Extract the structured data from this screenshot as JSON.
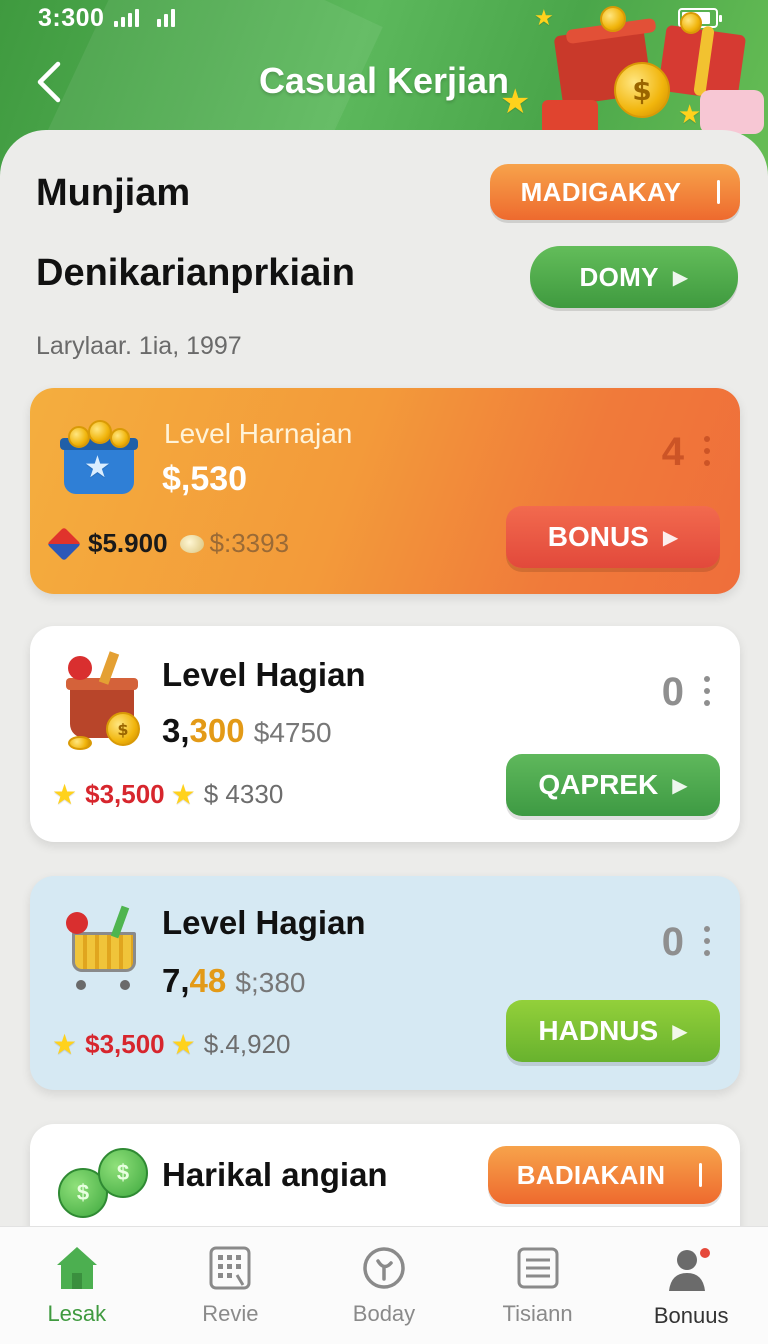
{
  "status_bar": {
    "time": "3:300"
  },
  "header": {
    "title": "Casual Kerjian"
  },
  "intro": {
    "title_line_1": "Munjiam",
    "title_line_2": "Denikarianprkiain",
    "subtitle": "Larylaar. 1ia, 1997",
    "top_button_label": "MADIGAKAY",
    "green_button_label": "DOMY"
  },
  "cards": [
    {
      "level_label": "Level Harnajan",
      "amount": "$,530",
      "counter": "4",
      "stat_primary": "$5.900",
      "stat_secondary": "$:3393",
      "button_label": "BONUS"
    },
    {
      "level_label": "Level Hagian",
      "amount_lead": "3,",
      "amount_highlight": "300",
      "amount_sub": "$4750",
      "counter": "0",
      "stat_primary": "$3,500",
      "stat_secondary": "$ 4330",
      "button_label": "QAPREK"
    },
    {
      "level_label": "Level Hagian",
      "amount_lead": "7,",
      "amount_highlight": "48",
      "amount_sub": "$;380",
      "counter": "0",
      "stat_primary": "$3,500",
      "stat_secondary": "$.4,920",
      "button_label": "HADNUS"
    },
    {
      "level_label": "Harikal angian",
      "button_label": "BADIAKAIN"
    }
  ],
  "nav": {
    "items": [
      {
        "label": "Lesak",
        "icon": "home-icon"
      },
      {
        "label": "Revie",
        "icon": "grid-icon"
      },
      {
        "label": "Boday",
        "icon": "compass-icon"
      },
      {
        "label": "Tisiann",
        "icon": "list-icon"
      },
      {
        "label": "Bonuus",
        "icon": "profile-icon"
      }
    ]
  },
  "colors": {
    "brand_green": "#4aa64a",
    "accent_orange": "#ee6a2e",
    "highlight_gold": "#e39a17",
    "value_red": "#d7262d"
  }
}
